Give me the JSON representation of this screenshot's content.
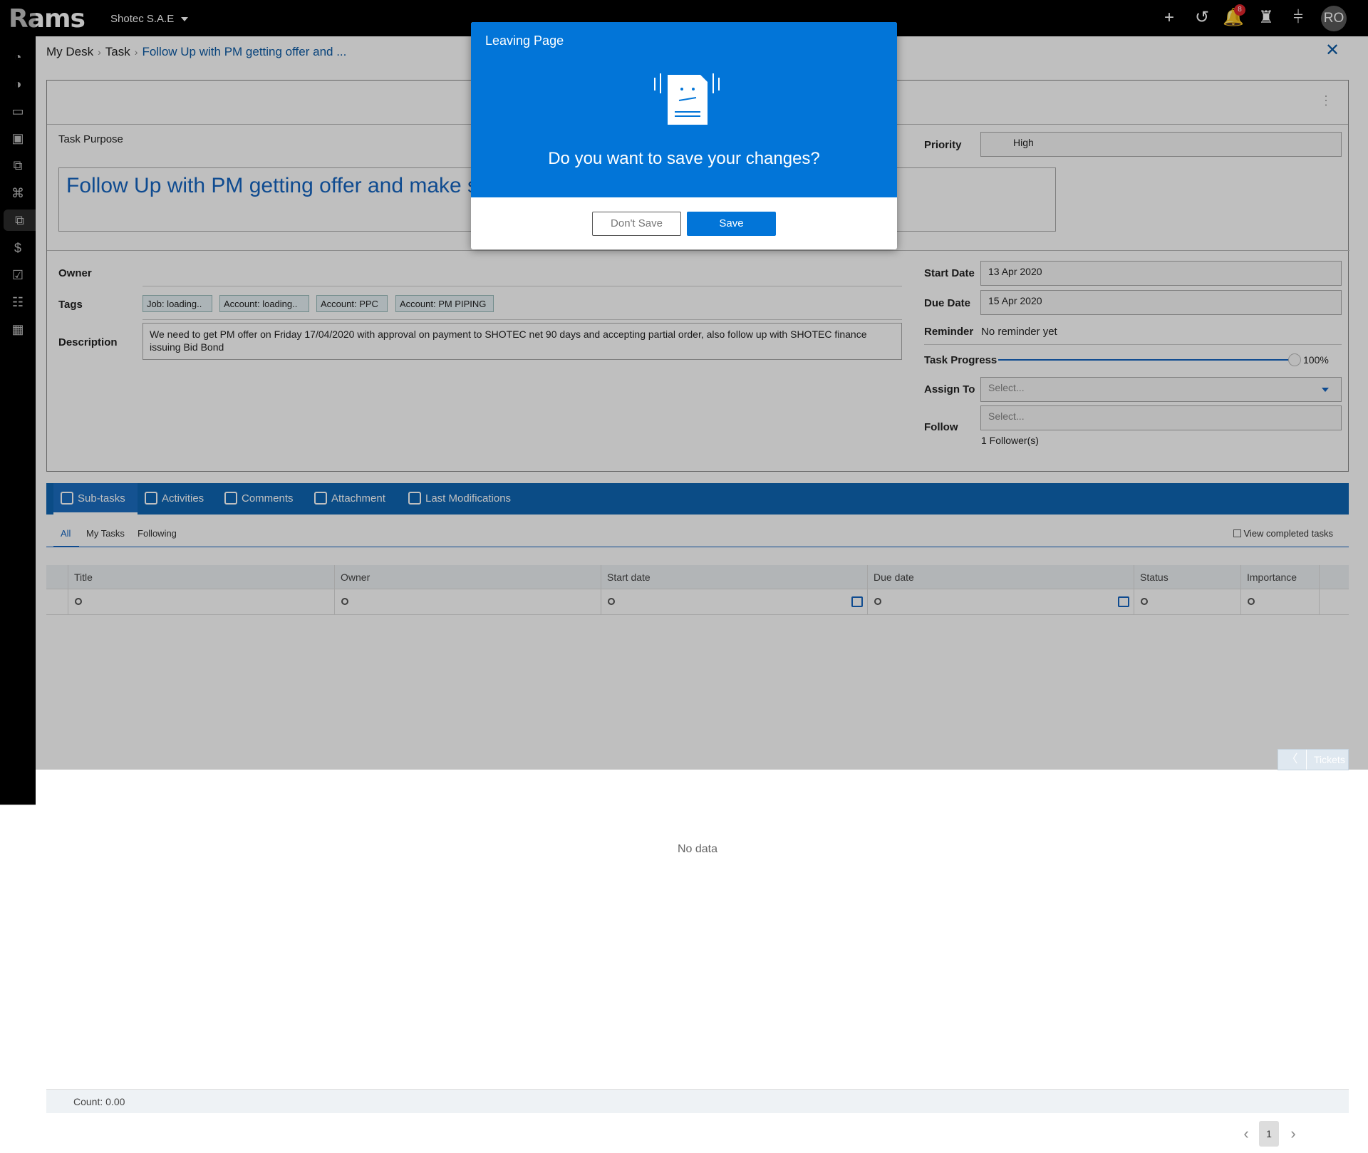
{
  "app": {
    "logo": "Rams",
    "company": "Shotec S.A.E",
    "avatar_initials": "RO",
    "notification_count": "8"
  },
  "breadcrumb": {
    "home": "My Desk",
    "section": "Task",
    "current": "Follow Up with PM getting offer and ..."
  },
  "task": {
    "purpose_label": "Task Purpose",
    "purpose_value": "Follow Up with PM getting offer and make su",
    "priority_label": "Priority",
    "priority_value": "High",
    "owner_label": "Owner",
    "tags_label": "Tags",
    "tags": [
      "Job: loading..",
      "Account: loading..",
      "Account: PPC",
      "Account: PM PIPING"
    ],
    "description_label": "Description",
    "description_value": "We need to get PM offer on Friday 17/04/2020 with approval on payment to SHOTEC net 90 days and accepting partial order, also follow up with SHOTEC finance issuing Bid Bond",
    "start_date_label": "Start Date",
    "start_date_value": "13 Apr 2020",
    "due_date_label": "Due Date",
    "due_date_value": "15 Apr 2020",
    "reminder_label": "Reminder",
    "reminder_value": "No reminder yet",
    "progress_label": "Task Progress",
    "progress_value": "100%",
    "progress_fraction": 1.0,
    "assign_label": "Assign To",
    "assign_placeholder": "Select...",
    "follow_label": "Follow",
    "follow_placeholder": "Select...",
    "followers": "1 Follower(s)"
  },
  "tabs": [
    {
      "label": "Sub-tasks",
      "icon": "subtasks-icon"
    },
    {
      "label": "Activities",
      "icon": "activities-icon"
    },
    {
      "label": "Comments",
      "icon": "comments-icon"
    },
    {
      "label": "Attachment",
      "icon": "attachment-icon"
    },
    {
      "label": "Last Modifications",
      "icon": "document-icon"
    }
  ],
  "subtabs": [
    "All",
    "My Tasks",
    "Following"
  ],
  "view_completed": "View completed tasks",
  "grid": {
    "columns": [
      "Title",
      "Owner",
      "Start date",
      "Due date",
      "Status",
      "Importance"
    ],
    "empty": "No data",
    "count": "Count: 0.00"
  },
  "pager": {
    "current": "1"
  },
  "tickets": "Tickets",
  "modal": {
    "title": "Leaving Page",
    "question": "Do you want to save your changes?",
    "dont_save": "Don't Save",
    "save": "Save"
  }
}
